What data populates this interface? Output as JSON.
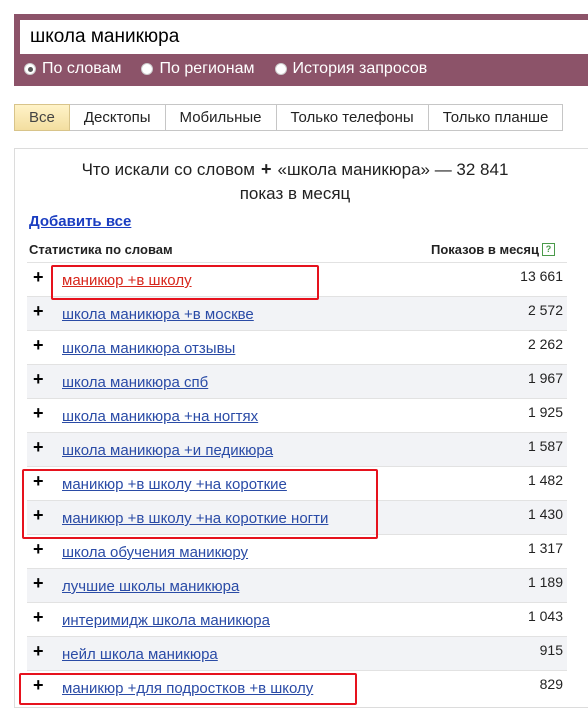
{
  "search": {
    "query": "школа маникюра"
  },
  "radio_options": [
    {
      "label": "По словам",
      "checked": true
    },
    {
      "label": "По регионам",
      "checked": false
    },
    {
      "label": "История запросов",
      "checked": false
    }
  ],
  "tabs": [
    {
      "label": "Все",
      "active": true
    },
    {
      "label": "Десктопы",
      "active": false
    },
    {
      "label": "Мобильные",
      "active": false
    },
    {
      "label": "Только телефоны",
      "active": false
    },
    {
      "label": "Только планше",
      "active": false
    }
  ],
  "summary": {
    "prefix": "Что искали со словом",
    "plus": "+",
    "rest": "«школа маникюра» — 32 841",
    "line2": "показ в месяц"
  },
  "add_all": "Добавить все",
  "columns": {
    "left": "Статистика по словам",
    "right": "Показов в месяц",
    "help": "?"
  },
  "rows": [
    {
      "plus": "+",
      "query": "маникюр +в школу",
      "count": "13 661",
      "highlighted_text": true
    },
    {
      "plus": "+",
      "query": "школа маникюра +в москве",
      "count": "2 572"
    },
    {
      "plus": "+",
      "query": "школа маникюра отзывы",
      "count": "2 262"
    },
    {
      "plus": "+",
      "query": "школа маникюра спб",
      "count": "1 967"
    },
    {
      "plus": "+",
      "query": "школа маникюра +на ногтях",
      "count": "1 925"
    },
    {
      "plus": "+",
      "query": "школа маникюра +и педикюра",
      "count": "1 587"
    },
    {
      "plus": "+",
      "query": "маникюр +в школу +на короткие",
      "count": "1 482"
    },
    {
      "plus": "+",
      "query": "маникюр +в школу +на короткие ногти",
      "count": "1 430"
    },
    {
      "plus": "+",
      "query": "школа обучения маникюру",
      "count": "1 317"
    },
    {
      "plus": "+",
      "query": "лучшие школы маникюра",
      "count": "1 189"
    },
    {
      "plus": "+",
      "query": "интеримидж школа маникюра",
      "count": "1 043"
    },
    {
      "plus": "+",
      "query": "нейл школа маникюра",
      "count": "915"
    },
    {
      "plus": "+",
      "query": "маникюр +для подростков +в школу",
      "count": "829"
    }
  ],
  "colors": {
    "header": "#8c5369",
    "link": "#2a4ba6",
    "highlight": "#e6121d",
    "active_query": "#d7261c"
  }
}
